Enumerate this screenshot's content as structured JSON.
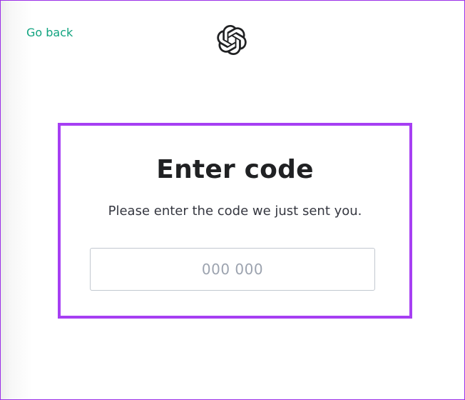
{
  "nav": {
    "go_back_label": "Go back"
  },
  "logo": {
    "icon": "openai-logo-icon"
  },
  "verify": {
    "title": "Enter code",
    "subtitle": "Please enter the code we just sent you.",
    "code_value": "",
    "code_placeholder": "000 000"
  },
  "colors": {
    "accent_link": "#10a37f",
    "highlight_border": "#a63ff3",
    "frame_border": "#9b30e8",
    "title_text": "#202123",
    "placeholder": "#9ca3af",
    "input_border": "#c2c8d0"
  }
}
